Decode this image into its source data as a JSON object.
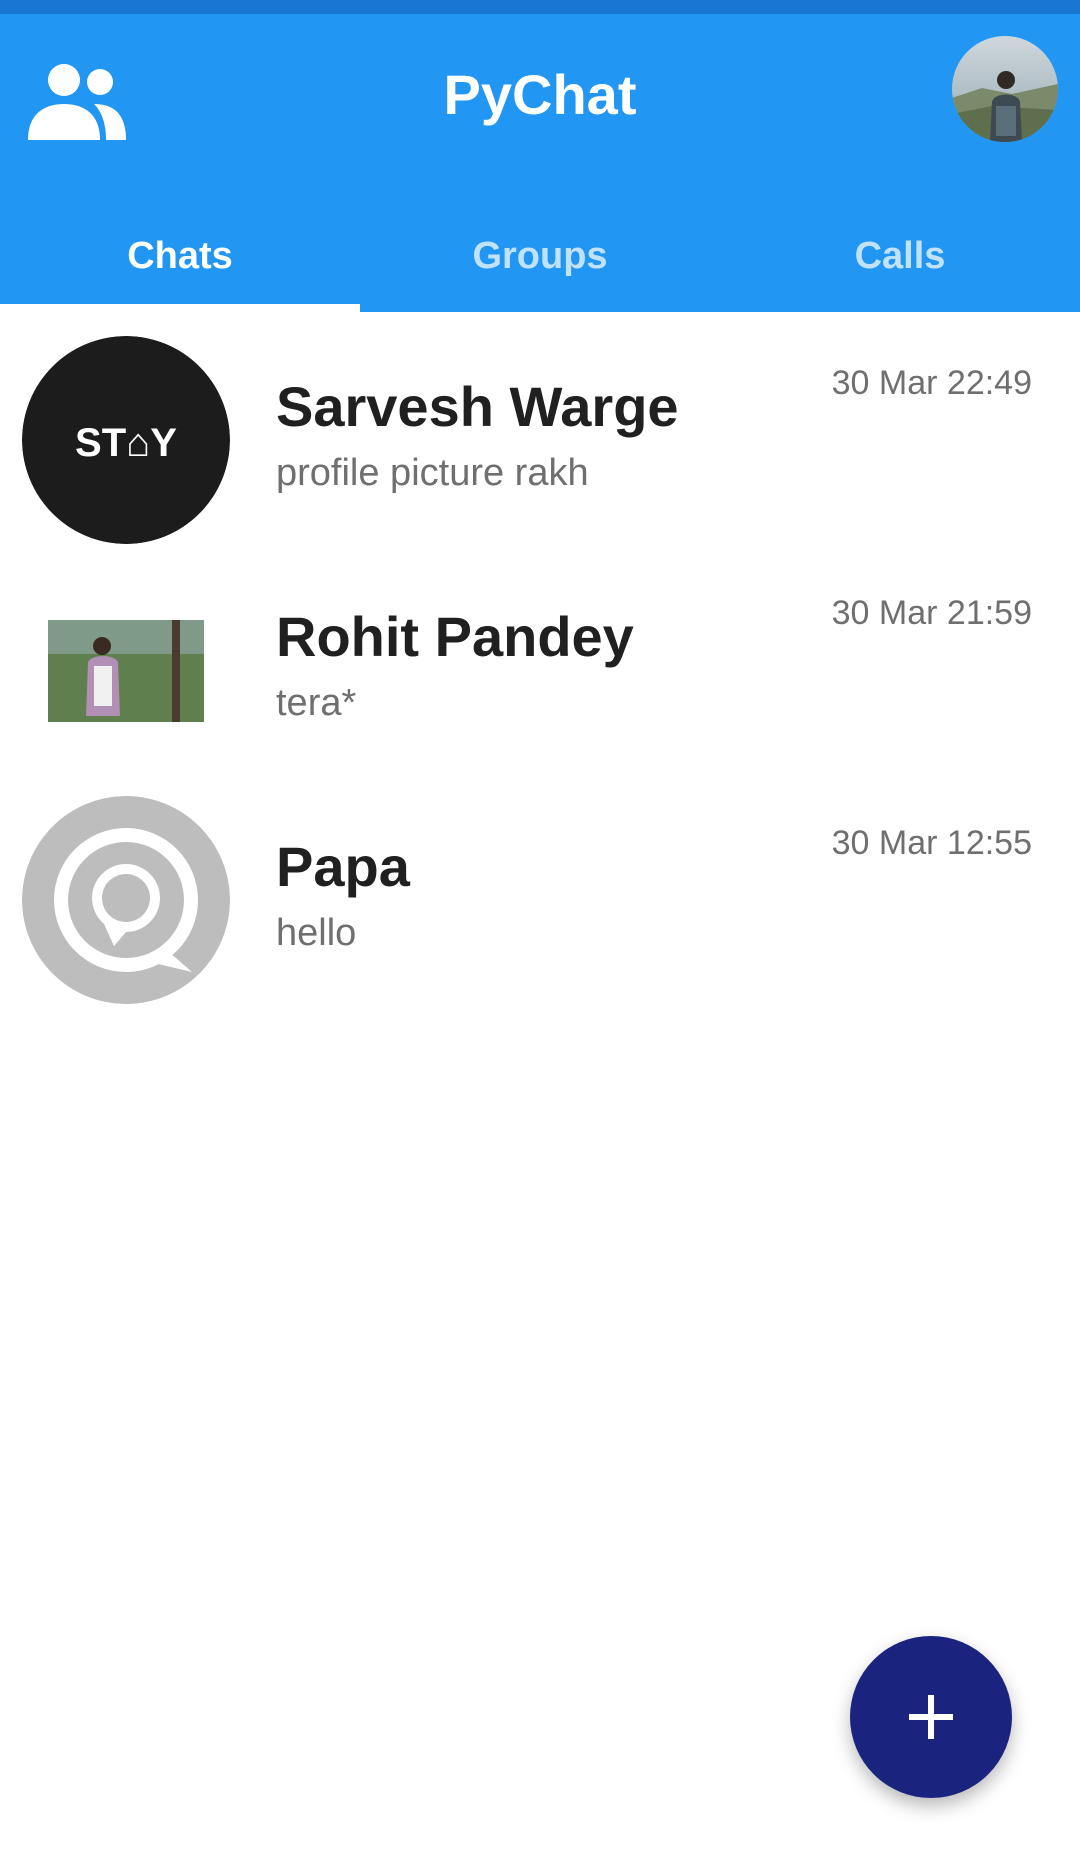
{
  "app": {
    "title": "PyChat",
    "contacts_icon": "people-icon",
    "profile_icon": "user-avatar"
  },
  "tabs": [
    {
      "label": "Chats",
      "active": true
    },
    {
      "label": "Groups",
      "active": false
    },
    {
      "label": "Calls",
      "active": false
    }
  ],
  "chats": [
    {
      "name": "Sarvesh Warge",
      "preview": "profile picture rakh",
      "time": "30 Mar 22:49",
      "avatar_text": "ST⌂Y"
    },
    {
      "name": "Rohit Pandey",
      "preview": "tera*",
      "time": "30 Mar 21:59"
    },
    {
      "name": "Papa",
      "preview": "hello",
      "time": "30 Mar 12:55"
    }
  ],
  "fab": {
    "icon": "plus-icon"
  },
  "colors": {
    "appbar": "#2196f3",
    "status_strip": "#1976d2",
    "fab": "#1a237e",
    "name_text": "#202020",
    "secondary_text": "#6f6f6f"
  }
}
